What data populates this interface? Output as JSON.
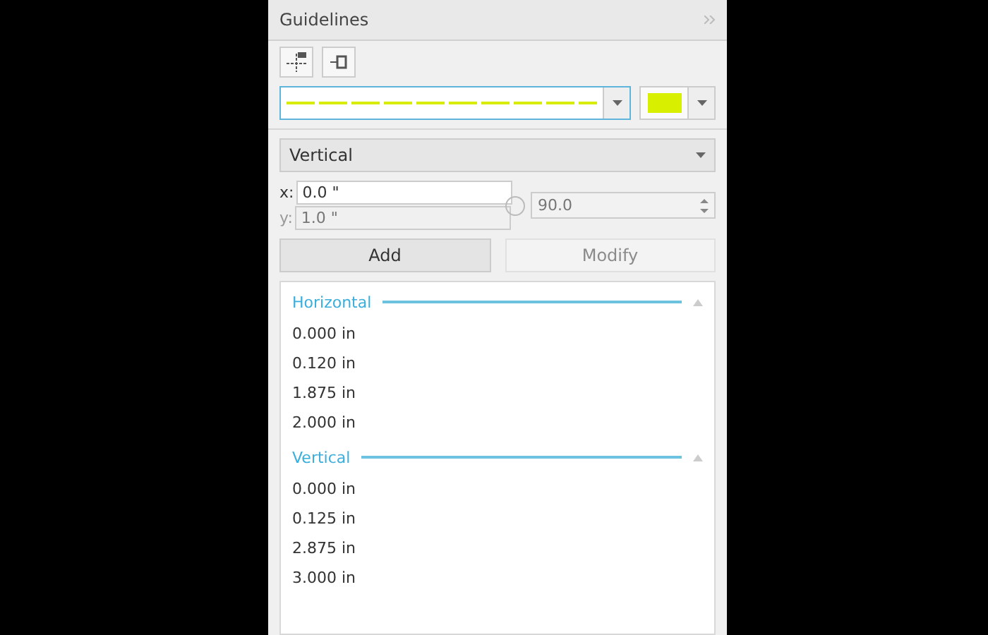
{
  "panel": {
    "title": "Guidelines"
  },
  "line_style": {
    "color": "#d8ec00"
  },
  "color_swatch": {
    "color": "#d8f000"
  },
  "orientation": {
    "value": "Vertical"
  },
  "fields": [
    {
      "label": "x:",
      "value": "0.0 \"",
      "disabled": false
    },
    {
      "label": "y:",
      "value": "1.0 \"",
      "disabled": true
    }
  ],
  "angle": {
    "value": "90.0",
    "disabled": true
  },
  "buttons": [
    {
      "label": "Add",
      "disabled": false
    },
    {
      "label": "Modify",
      "disabled": true
    }
  ],
  "groups": [
    {
      "title": "Horizontal",
      "items": [
        "0.000 in",
        "0.120 in",
        "1.875 in",
        "2.000 in"
      ]
    },
    {
      "title": "Vertical",
      "items": [
        "0.000 in",
        "0.125 in",
        "2.875 in",
        "3.000 in"
      ]
    }
  ]
}
